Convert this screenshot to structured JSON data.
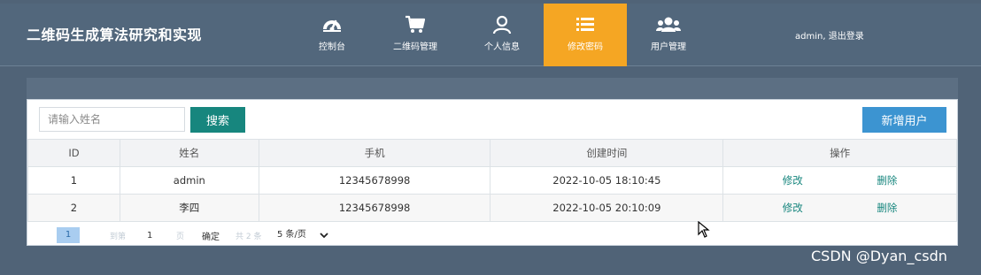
{
  "header": {
    "title": "二维码生成算法研究和实现",
    "nav": [
      {
        "label": "控制台",
        "icon": "dashboard-icon"
      },
      {
        "label": "二维码管理",
        "icon": "cart-icon"
      },
      {
        "label": "个人信息",
        "icon": "user-icon"
      },
      {
        "label": "修改密码",
        "icon": "list-icon",
        "active": true
      },
      {
        "label": "用户管理",
        "icon": "users-icon"
      }
    ],
    "user_text": "admin, 退出登录"
  },
  "toolbar": {
    "search_placeholder": "请输入姓名",
    "search_label": "搜索",
    "add_label": "新增用户"
  },
  "table": {
    "columns": [
      "ID",
      "姓名",
      "手机",
      "创建时间",
      "操作"
    ],
    "rows": [
      {
        "id": "1",
        "name": "admin",
        "phone": "12345678998",
        "created": "2022-10-05 18:10:45",
        "edit": "修改",
        "delete": "删除"
      },
      {
        "id": "2",
        "name": "李四",
        "phone": "12345678998",
        "created": "2022-10-05 20:10:09",
        "edit": "修改",
        "delete": "删除"
      }
    ]
  },
  "pagination": {
    "prev": "<",
    "current_page": "1",
    "next": ">",
    "goto_label": "到第",
    "goto_value": "1",
    "page_label": "页",
    "confirm_label": "确定",
    "total_label": "共 2 条",
    "page_size": "5 条/页"
  },
  "watermark": "CSDN @Dyan_csdn",
  "colors": {
    "accent": "#f5a623",
    "search_button": "#17867e",
    "add_button": "#3c94d1",
    "header_bg": "#52677c"
  }
}
